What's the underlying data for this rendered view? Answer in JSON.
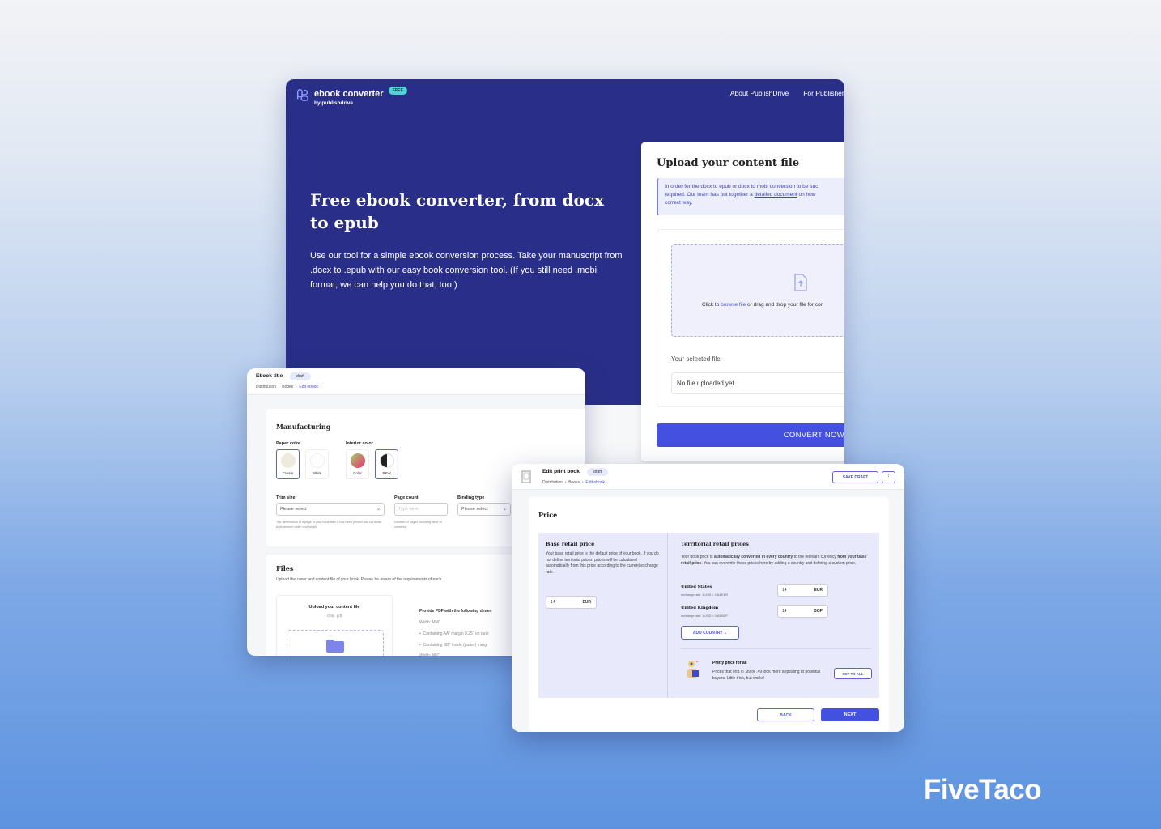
{
  "main_window": {
    "logo": {
      "title": "ebook converter",
      "subtitle": "by publishdrive",
      "badge": "FREE",
      "icon": "publishdrive-logo-icon"
    },
    "nav": [
      "About PublishDrive",
      "For Publishers"
    ],
    "hero": {
      "title": "Free ebook converter, from docx to epub",
      "description": "Use our tool for a simple ebook conversion process. Take your manuscript from .docx to .epub with our easy book conversion tool. (If you still need .mobi format, we can help you do that, too.)"
    },
    "upload": {
      "title": "Upload your content file",
      "info_before": "In order for the docx to epub or docx to mobi conversion to be suc",
      "info_line2_before": "required. Our team has put together a ",
      "info_link": "detailed document",
      "info_line2_after": " on how",
      "info_line3": "correct way.",
      "dropzone_before": "Click to ",
      "dropzone_link": "browse file",
      "dropzone_after": " or drag and drop your file for cor",
      "dropzone_icon": "file-upload-icon",
      "selected_label": "Your selected file",
      "selected_value": "No file uploaded yet",
      "convert_button": "CONVERT NOW"
    },
    "colors": {
      "hero_bg": "#292f88",
      "accent": "#4451e0",
      "badge": "#4fd5cf"
    }
  },
  "ebook_window": {
    "title": "Ebook title",
    "status": "draft",
    "breadcrumb": [
      "Distribution",
      "Books",
      "Edit ebook"
    ],
    "manufacturing": {
      "heading": "Manufacturing",
      "paper_color_label": "Paper color",
      "paper_colors": [
        {
          "label": "Cream",
          "color": "#efebdc",
          "selected": true
        },
        {
          "label": "White",
          "color": "#ffffff",
          "selected": false
        }
      ],
      "interior_color_label": "Interior color",
      "interior_colors": [
        {
          "label": "Color",
          "selected": false
        },
        {
          "label": "B&W",
          "selected": true
        }
      ],
      "trim_size": {
        "label": "Trim size",
        "value": "Please select",
        "hint": "The dimensions of a page of your book after it has been printed and cut down to its desired width and height."
      },
      "page_count": {
        "label": "Page count",
        "placeholder": "Type here",
        "hint": "Number of pages including table of contents"
      },
      "binding_type": {
        "label": "Binding type",
        "value": "Please select"
      }
    },
    "files": {
      "heading": "Files",
      "description": "Upload the cover and content file of your book. Please be aware of the requirements of each.",
      "content_upload_title": "Upload your content file",
      "content_upload_sub": "Only .pdf",
      "requirements_title": "Provide PDF with the following dimen",
      "requirements": [
        "Width: MM\"",
        "Containing AA\" margin 0.25\" on oute",
        "Containing BB\" inside (gutter) margi",
        "Width: NN\""
      ]
    }
  },
  "print_window": {
    "title": "Edit print book",
    "status": "draft",
    "breadcrumb": [
      "Distribution",
      "Books",
      "Edit ebook"
    ],
    "save_draft": "SAVE DRAFT",
    "more_icon": "more-vertical-icon",
    "price": {
      "heading": "Price",
      "base": {
        "heading": "Base retail price",
        "description": "Your base retail price is the default price of your book. If you do not define territorial prices, prices will be calculated automatically from this price according to the current exchange rate.",
        "value": "14",
        "currency": "EUR"
      },
      "territorial": {
        "heading": "Territorial retail prices",
        "desc_1": "Your book price is ",
        "desc_bold_1": "automatically converted in every country",
        "desc_2": " to the relevant currency ",
        "desc_bold_2": "from your base retail price",
        "desc_3": ". You can overwrite these prices here by adding a country and defining a custom price.",
        "countries": [
          {
            "name": "United States",
            "rate": "exchange rate: 1 USD = 0.84 EUR",
            "value": "14",
            "currency": "EUR"
          },
          {
            "name": "United Kingdom",
            "rate": "exchange rate: 1 USD = 0.84 BCP",
            "value": "14",
            "currency": "BGP"
          }
        ],
        "add_country": "ADD COUNTRY"
      },
      "pretty": {
        "title": "Pretty price for all",
        "text": "Prices that end in .99 or .49 look more appealing to potential buyers. Little trick, but works!",
        "button": "SET TO ALL"
      },
      "back": "BACK",
      "next": "NEXT"
    }
  },
  "watermark": "FiveTaco"
}
